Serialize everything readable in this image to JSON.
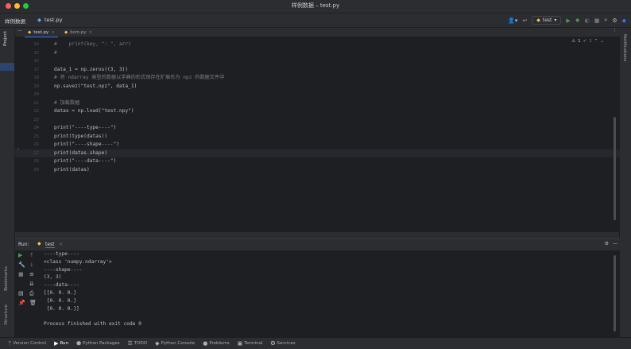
{
  "window": {
    "title": "样例数据 – test.py",
    "traffic_colors": [
      "#ff5f57",
      "#febc2e",
      "#28c840"
    ]
  },
  "navbar": {
    "project": "样例数据",
    "file": "test.py",
    "run_config": "test"
  },
  "left_tools": {
    "project": "Project",
    "bookmarks": "Bookmarks",
    "structure": "Structure"
  },
  "right_tools": {
    "notifications": "Notifications"
  },
  "tabs": [
    {
      "label": "test.py"
    },
    {
      "label": "bsm.py"
    }
  ],
  "editor": {
    "inspection": {
      "warnings": "1",
      "weak": "1"
    },
    "lines": [
      {
        "num": "14",
        "code": "#    print(key, \": \", arr)",
        "kind": "cmt"
      },
      {
        "num": "15",
        "code": "#",
        "kind": "cmt"
      },
      {
        "num": "16",
        "code": "",
        "kind": "plain"
      },
      {
        "num": "17",
        "code": "data_1 = np.zeros((3, 3))",
        "kind": "plain"
      },
      {
        "num": "18",
        "code": "# 将 ndarray 类型的数据以字典的形式保存在扩展名为 npz 的数据文件中",
        "kind": "cmt"
      },
      {
        "num": "19",
        "code": "np.savez(\"test.npz\", data_1)",
        "kind": "plain"
      },
      {
        "num": "20",
        "code": "",
        "kind": "plain"
      },
      {
        "num": "21",
        "code": "# 加载数据",
        "kind": "cmt"
      },
      {
        "num": "22",
        "code": "datas = np.load(\"test.npy\")",
        "kind": "plain"
      },
      {
        "num": "23",
        "code": "",
        "kind": "plain"
      },
      {
        "num": "24",
        "code": "print(\"----type----\")",
        "kind": "plain"
      },
      {
        "num": "25",
        "code": "print(type(datas))",
        "kind": "plain"
      },
      {
        "num": "26",
        "code": "print(\"----shape----\")",
        "kind": "plain"
      },
      {
        "num": "27",
        "code": "print(datas.shape)",
        "kind": "plain"
      },
      {
        "num": "28",
        "code": "print(\"----data----\")",
        "kind": "plain"
      },
      {
        "num": "29",
        "code": "print(datas)",
        "kind": "plain"
      }
    ]
  },
  "run": {
    "label": "Run:",
    "tab": "test",
    "output": [
      "----type----",
      "<class 'numpy.ndarray'>",
      "----shape----",
      "(3, 3)",
      "----data----",
      "[[0. 0. 0.]",
      " [0. 0. 0.]",
      " [0. 0. 0.]]",
      "",
      "Process finished with exit code 0"
    ]
  },
  "statusbar": [
    {
      "label": "Version Control",
      "icon": "branch-icon",
      "active": false
    },
    {
      "label": "Run",
      "icon": "play-icon",
      "active": true
    },
    {
      "label": "Python Packages",
      "icon": "package-icon",
      "active": false
    },
    {
      "label": "TODO",
      "icon": "list-icon",
      "active": false
    },
    {
      "label": "Python Console",
      "icon": "python-icon",
      "active": false
    },
    {
      "label": "Problems",
      "icon": "alert-icon",
      "active": false
    },
    {
      "label": "Terminal",
      "icon": "terminal-icon",
      "active": false
    },
    {
      "label": "Services",
      "icon": "services-icon",
      "active": false
    }
  ]
}
